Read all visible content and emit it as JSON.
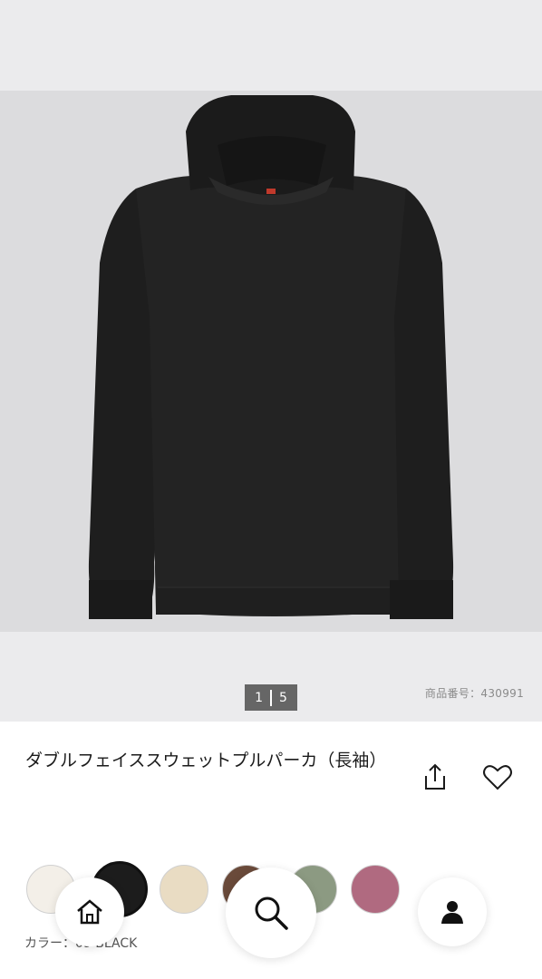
{
  "gallery": {
    "pager_current": "1",
    "pager_total": "5",
    "product_number": "商品番号：430991"
  },
  "product": {
    "title": "ダブルフェイススウェットプルパーカ（長袖）"
  },
  "actions": {
    "share_icon": "share-icon",
    "favorite_icon": "heart-icon"
  },
  "swatches": [
    {
      "color": "#f3efe8",
      "name": "off-white"
    },
    {
      "color": "#1c1c1c",
      "name": "black",
      "selected": true
    },
    {
      "color": "#e9dcc3",
      "name": "natural"
    },
    {
      "color": "#6a4a3a",
      "name": "brown"
    },
    {
      "color": "#8c9a82",
      "name": "olive"
    },
    {
      "color": "#b06a80",
      "name": "pink"
    }
  ],
  "color_label": "カラー：09 BLACK",
  "bottom_nav": {
    "home_icon": "home-icon",
    "search_icon": "search-icon",
    "account_icon": "account-icon"
  }
}
